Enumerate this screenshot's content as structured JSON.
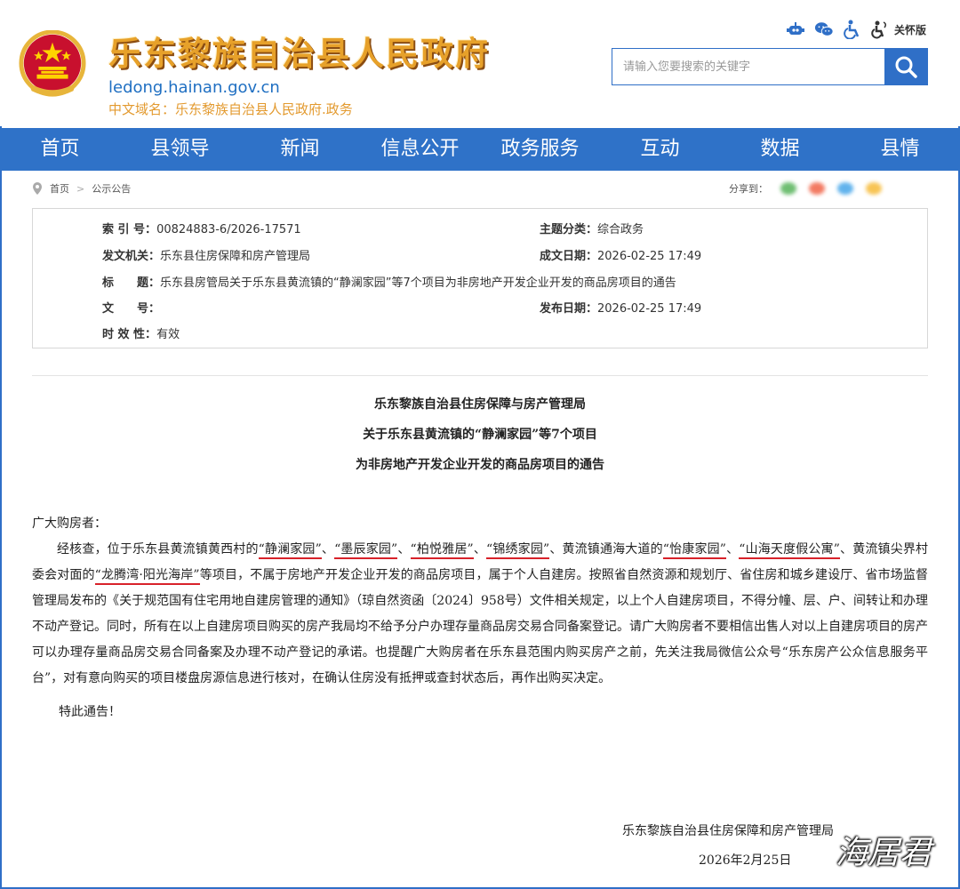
{
  "header": {
    "site_title": "乐东黎族自治县人民政府",
    "domain": "ledong.hainan.gov.cn",
    "cn_domain": "中文域名：乐东黎族自治县人民政府.政务",
    "care_label": "关怀版",
    "search_placeholder": "请输入您要搜索的关键字"
  },
  "nav": {
    "items": [
      "首页",
      "县领导",
      "新闻",
      "信息公开",
      "政务服务",
      "互动",
      "数据",
      "县情"
    ]
  },
  "breadcrumb": {
    "home": "首页",
    "section": "公示公告",
    "share_label": "分享到："
  },
  "meta": {
    "index_key": "索 引 号：",
    "index_value": "00824883-6/2026-17571",
    "topic_key": "主题分类：",
    "topic_value": "综合政务",
    "issuer_key": "发文机关：",
    "issuer_value": "乐东县住房保障和房产管理局",
    "created_key": "成文日期：",
    "created_value": "2026-02-25 17:49",
    "title_key": "标　　题：",
    "title_value": "乐东县房管局关于乐东县黄流镇的“静澜家园”等7个项目为非房地产开发企业开发的商品房项目的通告",
    "docno_key": "文　　号：",
    "docno_value": "",
    "published_key": "发布日期：",
    "published_value": "2026-02-25 17:49",
    "validity_key": "时 效 性：",
    "validity_value": "有效"
  },
  "article": {
    "title_line1": "乐东黎族自治县住房保障与房产管理局",
    "title_line2": "关于乐东县黄流镇的“静澜家园”等7个项目",
    "title_line3": "为非房地产开发企业开发的商品房项目的通告",
    "greeting": "广大购房者：",
    "p1": "经核查，位于乐东县黄流镇黄西村的",
    "proj1": "“静澜家园”",
    "sep1": "、",
    "proj2": "“墨辰家园”",
    "sep2": "、",
    "proj3": "“柏悦雅居”",
    "sep3": "、",
    "proj4": "“锦绣家园”",
    "p2": "、黄流镇通海大道的",
    "proj5": "“怡康家园”",
    "sep4": "、",
    "proj6": "“山海天度假公寓”",
    "p3": "、黄流镇尖界村委会对面的",
    "proj7": "“龙腾湾·阳光海岸”",
    "p4": "等项目，不属于房地产开发企业开发的商品房项目，属于个人自建房。按照省自然资源和规划厅、省住房和城乡建设厅、省市场监督管理局发布的《关于规范国有住宅用地自建房管理的通知》（琼自然资函〔2024〕958号）文件相关规定，以上个人自建房项目，不得分幢、层、户、间转让和办理不动产登记。同时，所有在以上自建房项目购买的房产我局均不给予分户办理存量商品房交易合同备案登记。请广大购房者不要相信出售人对以上自建房项目的房产可以办理存量商品房交易合同备案及办理不动产登记的承诺。也提醒广大购房者在乐东县范围内购买房产之前，先关注我局微信公众号“乐东房产公众信息服务平台”，对有意向购买的项目楼盘房源信息进行核对，在确认住房没有抵押或查封状态后，再作出购买决定。",
    "closing": "特此通告！",
    "sign_org": "乐东黎族自治县住房保障和房产管理局",
    "sign_date": "2026年2月25日"
  },
  "watermark": "海居君",
  "colors": {
    "nav_bg": "#2f72c8",
    "title_gold": "#e7a12a",
    "domain_blue": "#1f6fc2",
    "highlight_red": "#d8222a"
  },
  "icons": [
    "robot-icon",
    "wechat-icon",
    "accessibility-icon",
    "care-mode-icon",
    "search-icon",
    "location-icon",
    "chevron-right-icon"
  ]
}
